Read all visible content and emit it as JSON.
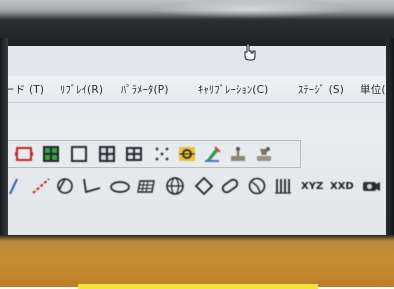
{
  "menu": {
    "items": [
      {
        "label": "ード (T)"
      },
      {
        "label": "ﾘﾌﾞﾚｲ(R)"
      },
      {
        "label": "ﾊﾟﾗﾒｰﾀ(P)"
      },
      {
        "label": "ｷｬﾘﾌﾞﾚｰｼｮﾝ(C)"
      },
      {
        "label": "ｽﾃｰｼﾞ (S)"
      },
      {
        "label": "単位("
      }
    ]
  },
  "toolbar_row2": {
    "xyz_label": "XYZ",
    "xxd_label": "XXD"
  },
  "colors": {
    "menu_text": "#2a2d31",
    "toolbar_bg": "#e8ebee",
    "yellow_tab": "#f3e33a"
  }
}
